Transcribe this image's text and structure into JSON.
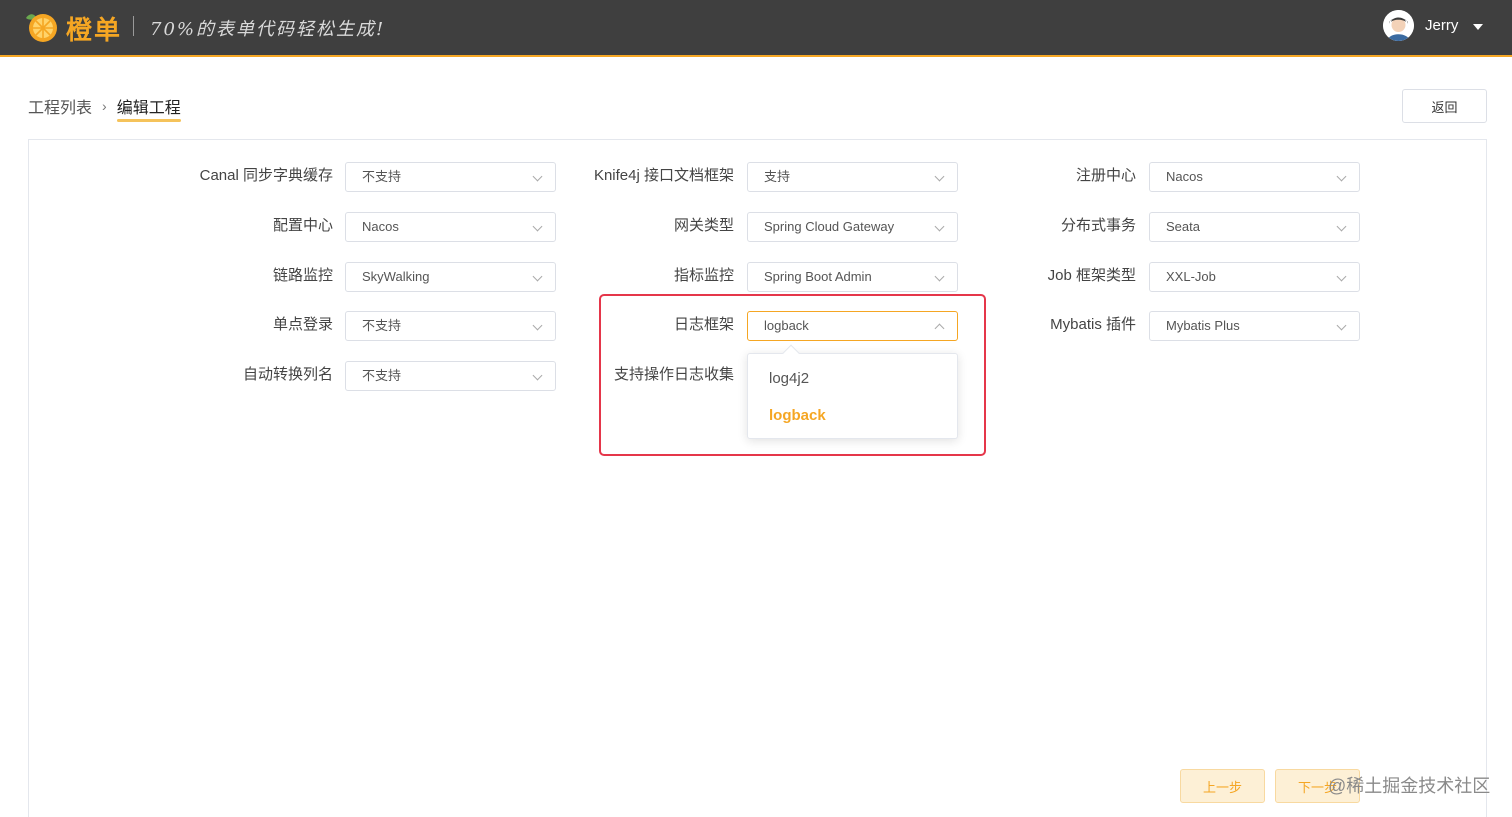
{
  "header": {
    "logo_text": "橙单",
    "slogan": "70%的表单代码轻松生成!",
    "user_name": "Jerry"
  },
  "breadcrumb": {
    "parent": "工程列表",
    "current": "编辑工程"
  },
  "actions": {
    "back_label": "返回",
    "prev_label": "上一步",
    "next_label": "下一步"
  },
  "form": {
    "fields": [
      {
        "label": "Canal 同步字典缓存",
        "value": "不支持"
      },
      {
        "label": "Knife4j 接口文档框架",
        "value": "支持"
      },
      {
        "label": "注册中心",
        "value": "Nacos"
      },
      {
        "label": "配置中心",
        "value": "Nacos"
      },
      {
        "label": "网关类型",
        "value": "Spring Cloud Gateway"
      },
      {
        "label": "分布式事务",
        "value": "Seata"
      },
      {
        "label": "链路监控",
        "value": "SkyWalking"
      },
      {
        "label": "指标监控",
        "value": "Spring Boot Admin"
      },
      {
        "label": "Job 框架类型",
        "value": "XXL-Job"
      },
      {
        "label": "单点登录",
        "value": "不支持"
      },
      {
        "label": "日志框架",
        "value": "logback"
      },
      {
        "label": "Mybatis 插件",
        "value": "Mybatis Plus"
      },
      {
        "label": "自动转换列名",
        "value": "不支持"
      },
      {
        "label": "支持操作日志收集",
        "value": ""
      }
    ],
    "dropdown_options": [
      "log4j2",
      "logback"
    ],
    "selected_option": "logback"
  },
  "watermark": "@稀土掘金技术社区",
  "colors": {
    "accent": "#f5a623",
    "header_bg": "#3f3f3f",
    "highlight": "#e5364a"
  }
}
